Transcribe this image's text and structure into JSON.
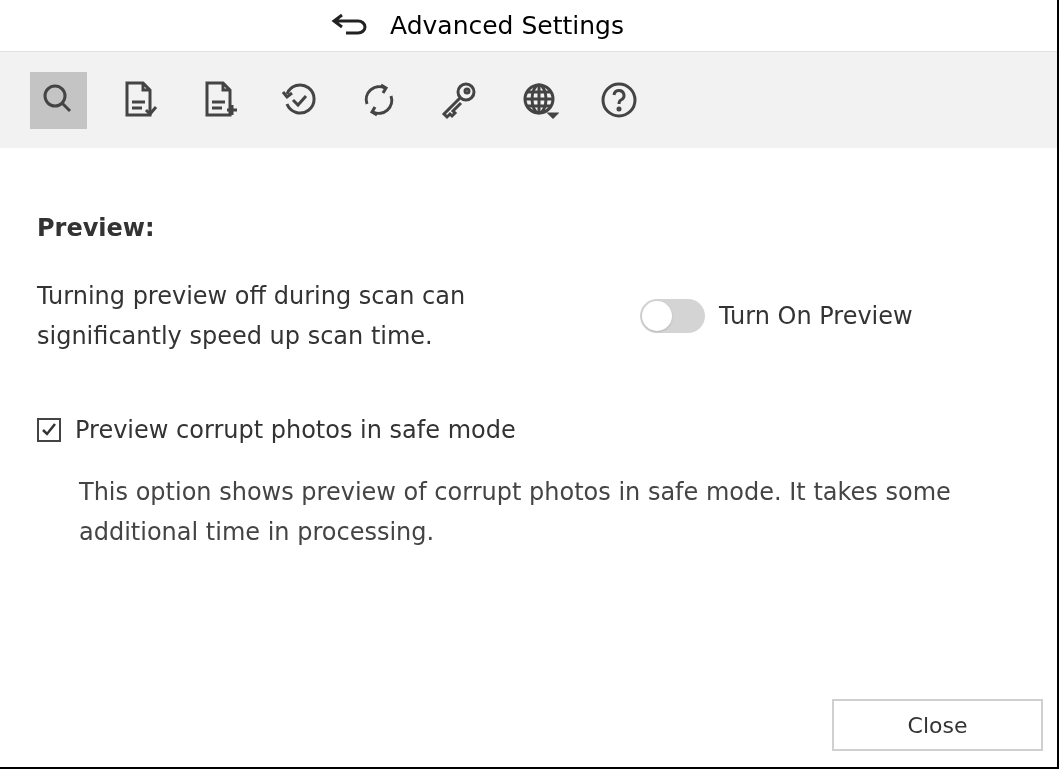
{
  "window": {
    "title": "Advanced Settings"
  },
  "toolbar": [
    {
      "kind": "search",
      "selected": true
    },
    {
      "kind": "doc-check",
      "selected": false
    },
    {
      "kind": "doc-add",
      "selected": false
    },
    {
      "kind": "history",
      "selected": false
    },
    {
      "kind": "refresh",
      "selected": false
    },
    {
      "kind": "key",
      "selected": false
    },
    {
      "kind": "globe",
      "selected": false
    },
    {
      "kind": "help",
      "selected": false
    }
  ],
  "section": {
    "heading": "Preview:",
    "description": "Turning preview off during scan can significantly speed up scan time.",
    "toggle": {
      "label": "Turn On Preview",
      "on": false
    }
  },
  "option": {
    "label": "Preview corrupt photos in safe mode",
    "checked": true,
    "description": "This option shows preview of corrupt photos in safe mode. It takes some additional time in processing."
  },
  "buttons": [
    "Close"
  ]
}
